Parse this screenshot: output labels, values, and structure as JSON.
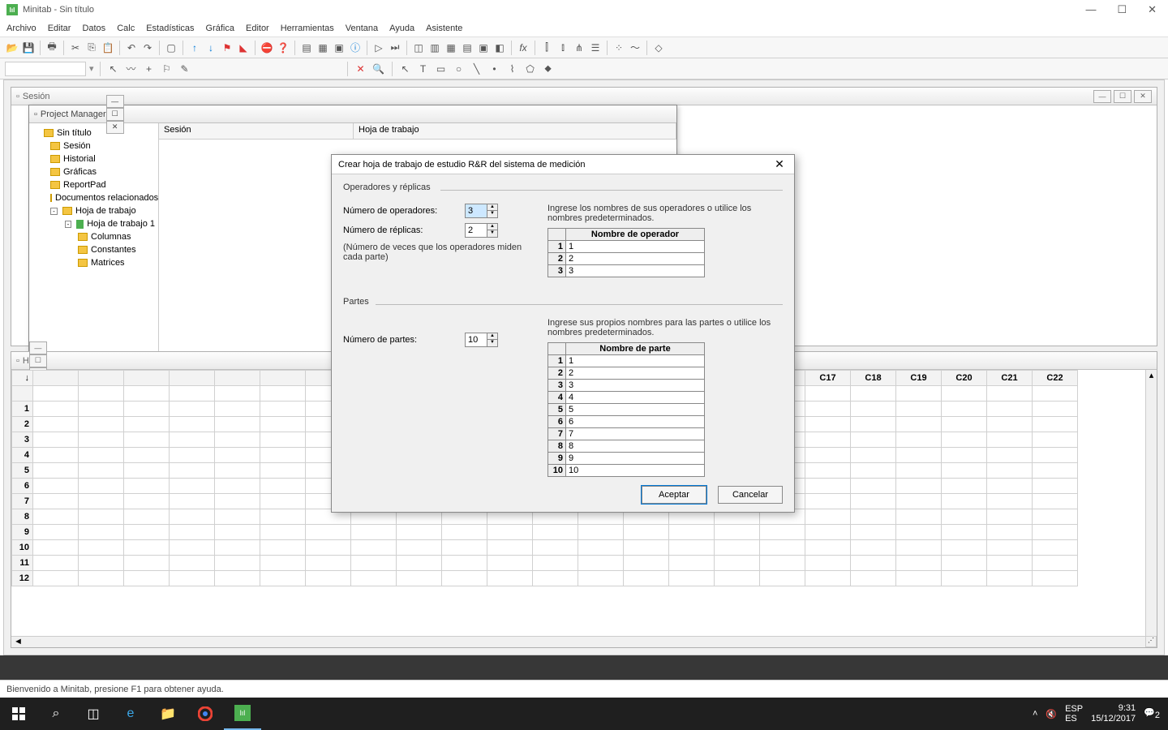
{
  "app": {
    "title": "Minitab - Sin título"
  },
  "win_controls": {
    "min": "—",
    "max": "☐",
    "close": "✕"
  },
  "menu": [
    "Archivo",
    "Editar",
    "Datos",
    "Calc",
    "Estadísticas",
    "Gráfica",
    "Editor",
    "Herramientas",
    "Ventana",
    "Ayuda",
    "Asistente"
  ],
  "session": {
    "title": "Sesión"
  },
  "project_manager": {
    "title": "Project Manager",
    "cols": {
      "session": "Sesión",
      "worksheet": "Hoja de trabajo"
    },
    "tree": {
      "root": "Sin título",
      "sesion": "Sesión",
      "historial": "Historial",
      "graficas": "Gráficas",
      "reportpad": "ReportPad",
      "docs": "Documentos relacionados",
      "hoja": "Hoja de trabajo",
      "hoja1": "Hoja de trabajo 1",
      "columnas": "Columnas",
      "constantes": "Constantes",
      "matrices": "Matrices"
    }
  },
  "worksheet": {
    "title": "H",
    "visible_cols": [
      "C17",
      "C18",
      "C19",
      "C20",
      "C21",
      "C22"
    ],
    "visible_rows": [
      "1",
      "2",
      "3",
      "4",
      "5",
      "6",
      "7",
      "8",
      "9",
      "10",
      "11",
      "12"
    ]
  },
  "dialog": {
    "title": "Crear hoja de trabajo de estudio R&R del sistema de medición",
    "sec1": "Operadores y réplicas",
    "sec2": "Partes",
    "num_op_label": "Número de operadores:",
    "num_op_value": "3",
    "num_rep_label": "Número de réplicas:",
    "num_rep_value": "2",
    "rep_note": "(Número de veces que los operadores miden cada parte)",
    "op_hint": "Ingrese los nombres de sus operadores o utilice los nombres predeterminados.",
    "op_header": "Nombre de operador",
    "operators": [
      {
        "i": "1",
        "n": "1"
      },
      {
        "i": "2",
        "n": "2"
      },
      {
        "i": "3",
        "n": "3"
      }
    ],
    "num_parts_label": "Número de partes:",
    "num_parts_value": "10",
    "parts_hint": "Ingrese sus propios nombres para las partes o utilice los nombres predeterminados.",
    "parts_header": "Nombre de parte",
    "parts": [
      {
        "i": "1",
        "n": "1"
      },
      {
        "i": "2",
        "n": "2"
      },
      {
        "i": "3",
        "n": "3"
      },
      {
        "i": "4",
        "n": "4"
      },
      {
        "i": "5",
        "n": "5"
      },
      {
        "i": "6",
        "n": "6"
      },
      {
        "i": "7",
        "n": "7"
      },
      {
        "i": "8",
        "n": "8"
      },
      {
        "i": "9",
        "n": "9"
      },
      {
        "i": "10",
        "n": "10"
      }
    ],
    "accept": "Aceptar",
    "cancel": "Cancelar"
  },
  "statusbar": {
    "text": "Bienvenido a Minitab, presione F1 para obtener ayuda."
  },
  "taskbar": {
    "lang": "ESP",
    "lang2": "ES",
    "time": "9:31",
    "date": "15/12/2017",
    "notif": "2"
  }
}
